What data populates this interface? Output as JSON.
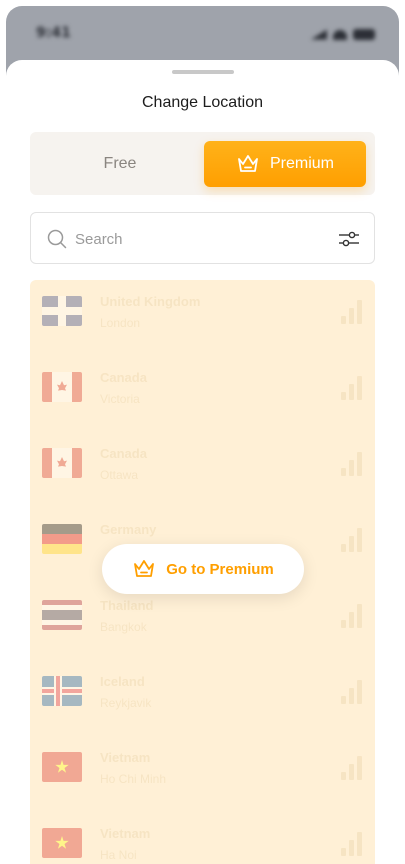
{
  "status": {
    "time": "9:41"
  },
  "sheet": {
    "title": "Change Location"
  },
  "tabs": {
    "free": "Free",
    "premium": "Premium"
  },
  "search": {
    "placeholder": "Search"
  },
  "locations": [
    {
      "country": "United Kingdom",
      "city": "London",
      "flag": "uk",
      "signal": 3
    },
    {
      "country": "Canada",
      "city": "Victoria",
      "flag": "ca",
      "signal": 3
    },
    {
      "country": "Canada",
      "city": "Ottawa",
      "flag": "ca",
      "signal": 3
    },
    {
      "country": "Germany",
      "city": "",
      "flag": "de",
      "signal": 3
    },
    {
      "country": "Thailand",
      "city": "Bangkok",
      "flag": "th",
      "signal": 3
    },
    {
      "country": "Iceland",
      "city": "Reykjavik",
      "flag": "is",
      "signal": 3
    },
    {
      "country": "Vietnam",
      "city": "Ho Chi Minh",
      "flag": "vn",
      "signal": 3
    },
    {
      "country": "Vietnam",
      "city": "Ha Noi",
      "flag": "vn",
      "signal": 3
    }
  ],
  "cta": {
    "label": "Go to Premium"
  },
  "colors": {
    "accent": "#ff9f00",
    "list_bg": "#fff0d6"
  }
}
